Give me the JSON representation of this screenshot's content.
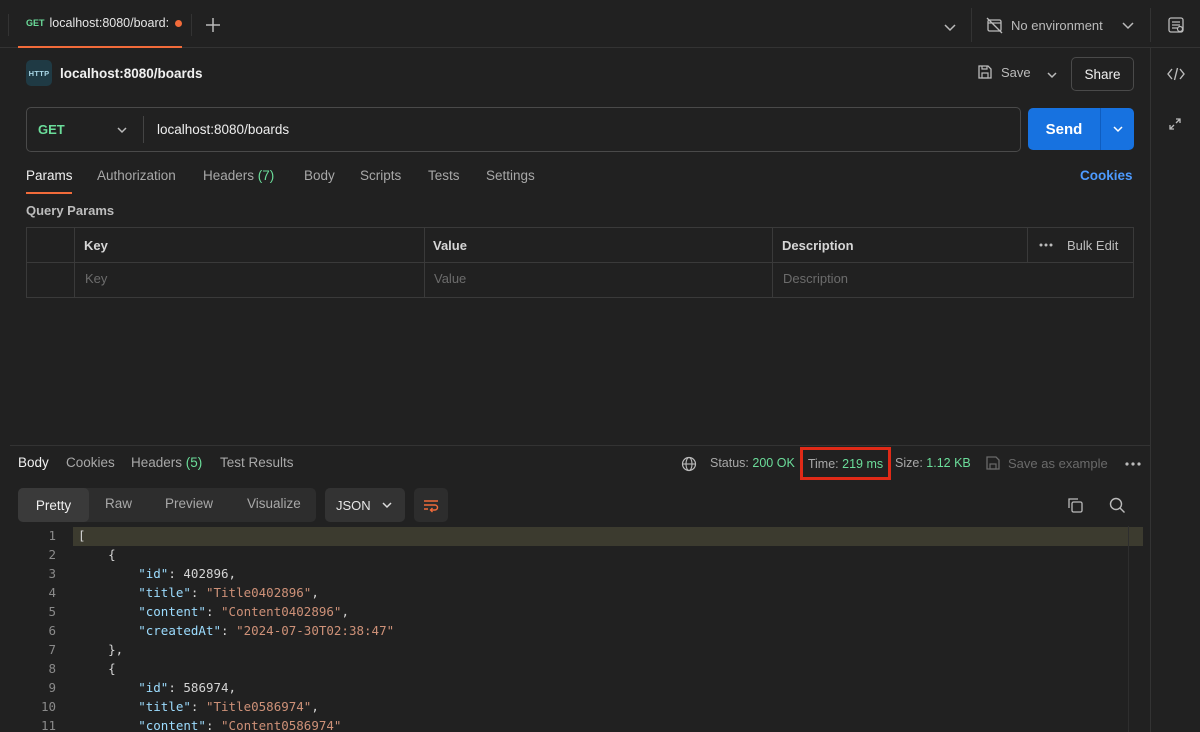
{
  "tabs": [
    {
      "method": "GET",
      "title": "localhost:8080/board:"
    }
  ],
  "environment": {
    "label": "No environment"
  },
  "request": {
    "badge": "HTTP",
    "title": "localhost:8080/boards",
    "save_label": "Save",
    "share_label": "Share",
    "method": "GET",
    "url": "localhost:8080/boards",
    "send_label": "Send"
  },
  "request_tabs": [
    {
      "label": "Params",
      "count": ""
    },
    {
      "label": "Authorization",
      "count": ""
    },
    {
      "label": "Headers",
      "count": "(7)"
    },
    {
      "label": "Body",
      "count": ""
    },
    {
      "label": "Scripts",
      "count": ""
    },
    {
      "label": "Tests",
      "count": ""
    },
    {
      "label": "Settings",
      "count": ""
    }
  ],
  "cookies_link": "Cookies",
  "query_params": {
    "title": "Query Params",
    "columns": [
      "Key",
      "Value",
      "Description"
    ],
    "bulk_edit": "Bulk Edit",
    "placeholders": {
      "key": "Key",
      "value": "Value",
      "description": "Description"
    }
  },
  "response": {
    "tabs": [
      {
        "label": "Body",
        "count": ""
      },
      {
        "label": "Cookies",
        "count": ""
      },
      {
        "label": "Headers",
        "count": "(5)"
      },
      {
        "label": "Test Results",
        "count": ""
      }
    ],
    "status_label": "Status:",
    "status_value": "200 OK",
    "time_label": "Time:",
    "time_value": "219 ms",
    "size_label": "Size:",
    "size_value": "1.12 KB",
    "save_example": "Save as example",
    "formats": [
      "Pretty",
      "Raw",
      "Preview",
      "Visualize"
    ],
    "language": "JSON",
    "line_numbers": [
      "1",
      "2",
      "3",
      "4",
      "5",
      "6",
      "7",
      "8",
      "9",
      "10",
      "11"
    ]
  },
  "json_body": [
    {
      "id": 402896,
      "title": "Title0402896",
      "content": "Content0402896",
      "createdAt": "2024-07-30T02:38:47"
    },
    {
      "id": 586974,
      "title": "Title0586974",
      "content": "Content0586974"
    }
  ],
  "colors": {
    "accent": "#f26b3a",
    "send": "#1772e0",
    "get_method": "#6bdd9a",
    "link": "#4d9bff",
    "highlight_box": "#e02a17"
  }
}
